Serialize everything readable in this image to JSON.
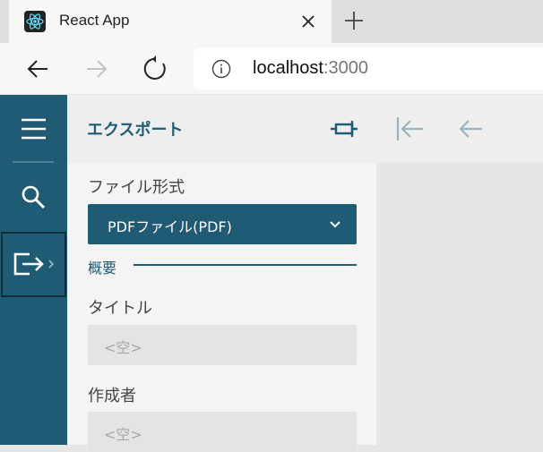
{
  "browser": {
    "tab_title": "React App",
    "url_host": "localhost",
    "url_port": ":3000"
  },
  "panel": {
    "title": "エクスポート",
    "file_format_label": "ファイル形式",
    "file_format_value": "PDFファイル(PDF)",
    "section_label": "概要",
    "title_label": "タイトル",
    "title_placeholder": "<空>",
    "author_label": "作成者",
    "author_placeholder": "<空>"
  },
  "colors": {
    "primary": "#1f5b74",
    "panel_bg": "#f4f4f4",
    "content_bg": "#e6e6e6"
  }
}
